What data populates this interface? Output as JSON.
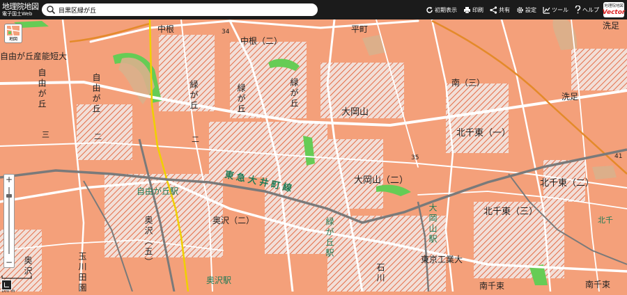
{
  "header": {
    "logo_line1": "地理院地図",
    "logo_line2": "電子国土Web",
    "search_value": "目黒区緑が丘",
    "tools": [
      {
        "label": "初期表示",
        "icon": "refresh-icon"
      },
      {
        "label": "印刷",
        "icon": "print-icon"
      },
      {
        "label": "共有",
        "icon": "share-icon"
      },
      {
        "label": "設定",
        "icon": "gear-icon"
      },
      {
        "label": "ツール",
        "icon": "tool-icon"
      },
      {
        "label": "ヘルプ",
        "icon": "help-icon"
      }
    ],
    "vector_line1": "地理院地図",
    "vector_line2": "Vector"
  },
  "controls": {
    "layer_label": "地図",
    "zoom_in": "+",
    "zoom_out": "−",
    "scale_text": "100 m"
  },
  "map": {
    "colors": {
      "zone_fill": "#f4a07a",
      "topbar": "#1b1b1b",
      "park": "#66cc55",
      "rail": "#7a7a7a",
      "expressway": "#f0d000"
    },
    "labels": {
      "nakane": "中根",
      "nakane_ni": "中根（二）",
      "jiyugaoka_tanki": "自由が丘産能短大",
      "jiyugaoka_v1": "自由が丘",
      "jiyugaoka_v2": "自由が丘",
      "jiyugaoka_san": "三",
      "jiyugaoka_ni": "二",
      "midorigaoka_v1": "緑が丘",
      "midorigaoka_ni": "二",
      "oookayama": "大岡山",
      "oookayama_ni": "大岡山（二）",
      "kitasenzoku_ichi": "北千東（一）",
      "kitasenzoku_ni": "北千東（二）",
      "kitasenzoku_san": "北千東（三）",
      "minami_san": "南（三）",
      "senzoku": "洗足",
      "senzoku2": "洗足",
      "kitasenzoku_short": "北千",
      "okusawa_ni": "奥沢（二）",
      "okusawa_go": "奥沢（五）",
      "okusawa": "奥沢",
      "tamagawa": "玉川田園",
      "ishikawa": "石川",
      "tokyo_kogyo": "東京工業大",
      "minami_senzoku": "南千束",
      "minami_senzoku2": "南千束",
      "hiracho": "平町",
      "tokyu_oimachi": "東急大井町線",
      "jiyugaoka_station": "自由が丘駅",
      "midorigaoka_station": "緑が丘駅",
      "oookayama_station": "大岡山駅",
      "okusawa_station": "奥沢駅",
      "alt_34": "34",
      "alt_35": "35",
      "alt_41": "41"
    }
  }
}
